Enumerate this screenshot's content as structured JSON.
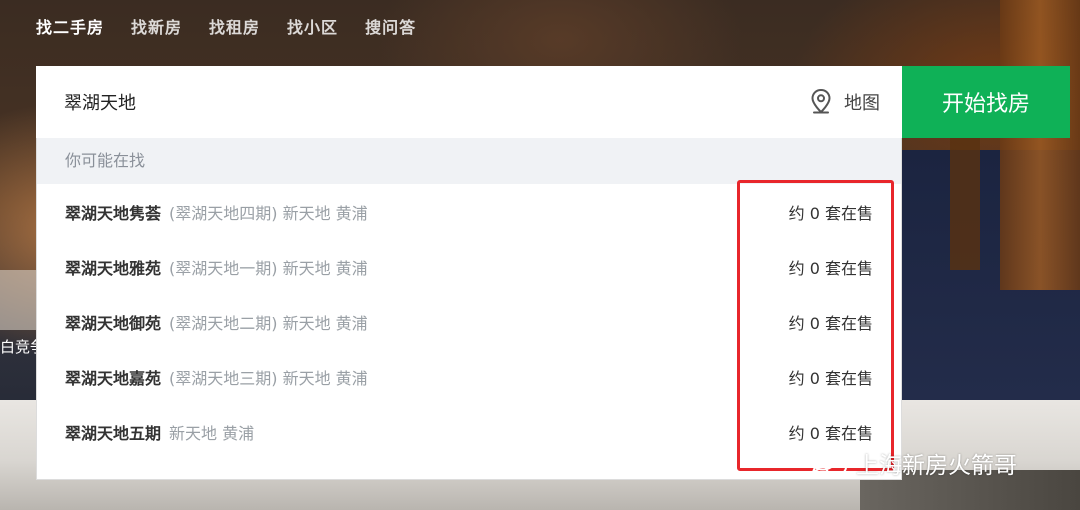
{
  "tabs": [
    {
      "label": "找二手房",
      "active": true
    },
    {
      "label": "找新房",
      "active": false
    },
    {
      "label": "找租房",
      "active": false
    },
    {
      "label": "找小区",
      "active": false
    },
    {
      "label": "搜问答",
      "active": false
    }
  ],
  "search": {
    "value": "翠湖天地",
    "map_label": "地图",
    "map_icon": "map-pin-icon",
    "button_label": "开始找房",
    "button_color": "#0fb157"
  },
  "dropdown": {
    "header": "你可能在找",
    "suggestions": [
      {
        "name": "翠湖天地隽荟",
        "sub": "(翠湖天地四期) 新天地 黄浦",
        "count": "约 0 套在售"
      },
      {
        "name": "翠湖天地雅苑",
        "sub": "(翠湖天地一期) 新天地 黄浦",
        "count": "约 0 套在售"
      },
      {
        "name": "翠湖天地御苑",
        "sub": "(翠湖天地二期) 新天地 黄浦",
        "count": "约 0 套在售"
      },
      {
        "name": "翠湖天地嘉苑",
        "sub": "(翠湖天地三期) 新天地 黄浦",
        "count": "约 0 套在售"
      },
      {
        "name": "翠湖天地五期",
        "sub": "新天地 黄浦",
        "count": "约 0 套在售"
      }
    ],
    "highlight_color": "#e8262b"
  },
  "background": {
    "cutoff_text": "白竞争"
  },
  "watermark": {
    "text": "上海新房火箭哥",
    "icon": "wechat-icon"
  }
}
